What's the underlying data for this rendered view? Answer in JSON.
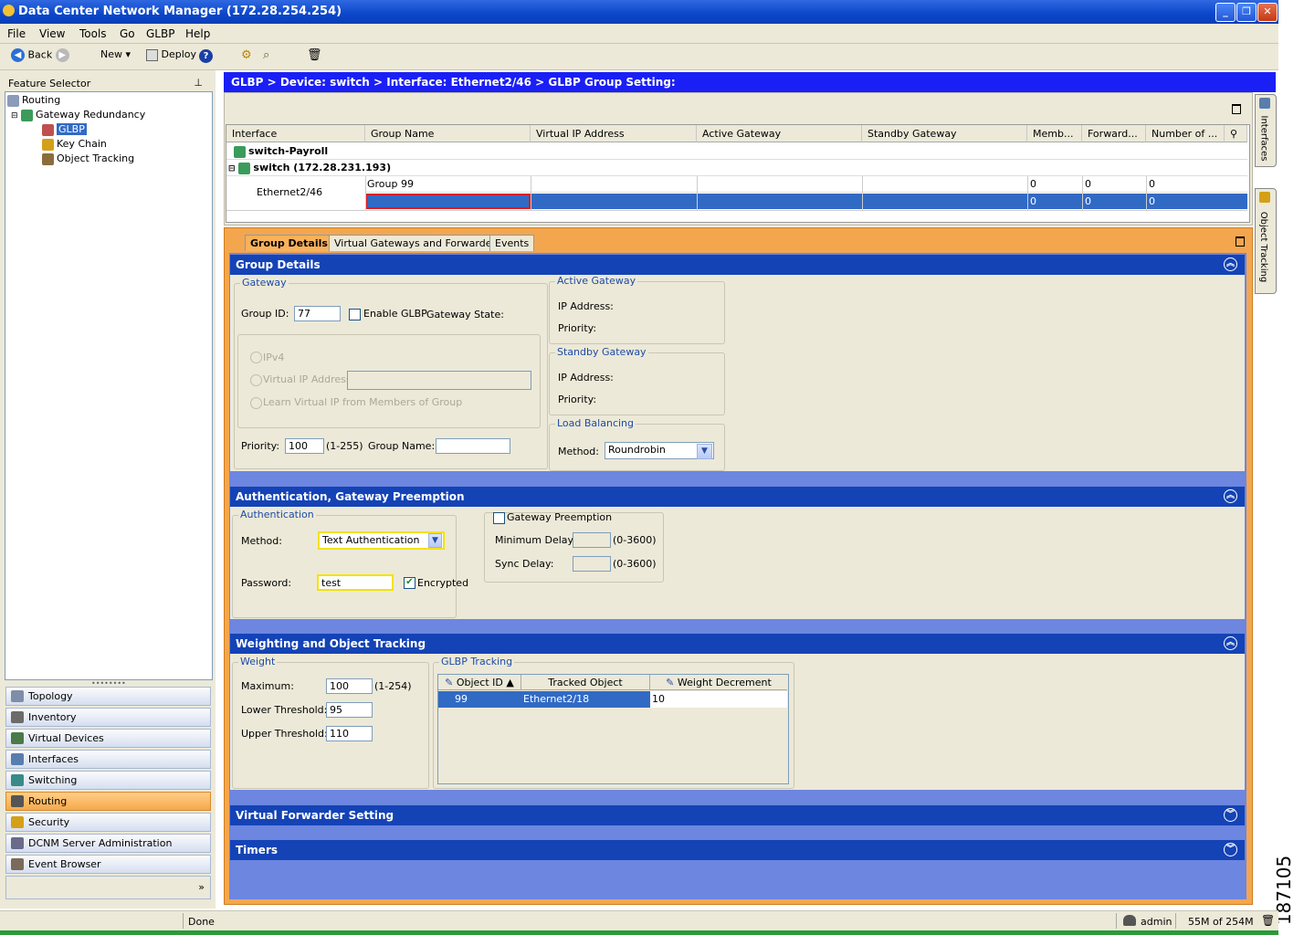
{
  "window": {
    "title": "Data Center Network Manager (172.28.254.254)"
  },
  "menu": [
    "File",
    "View",
    "Tools",
    "Go",
    "GLBP",
    "Help"
  ],
  "toolbar": {
    "back": "Back",
    "new": "New",
    "deploy": "Deploy"
  },
  "feature_selector": {
    "title": "Feature Selector",
    "tree": [
      "Routing",
      "Gateway Redundancy",
      "GLBP",
      "Key Chain",
      "Object Tracking"
    ]
  },
  "nav": [
    {
      "label": "Topology",
      "selected": false
    },
    {
      "label": "Inventory",
      "selected": false
    },
    {
      "label": "Virtual Devices",
      "selected": false
    },
    {
      "label": "Interfaces",
      "selected": false
    },
    {
      "label": "Switching",
      "selected": false
    },
    {
      "label": "Routing",
      "selected": true
    },
    {
      "label": "Security",
      "selected": false
    },
    {
      "label": "DCNM Server Administration",
      "selected": false
    },
    {
      "label": "Event Browser",
      "selected": false
    }
  ],
  "breadcrumb": "GLBP > Device: switch > Interface: Ethernet2/46 > GLBP Group Setting:",
  "grid": {
    "columns": [
      "Interface",
      "Group Name",
      "Virtual IP Address",
      "Active Gateway",
      "Standby Gateway",
      "Memb...",
      "Forward...",
      "Number of ..."
    ],
    "device1": "switch-Payroll",
    "device2": "switch (172.28.231.193)",
    "interface": "Ethernet2/46",
    "row1": {
      "group": "Group 99",
      "memb": "0",
      "forward": "0",
      "number": "0"
    },
    "row2": {
      "group": "",
      "memb": "0",
      "forward": "0",
      "number": "0"
    }
  },
  "tabs": [
    "Group Details",
    "Virtual Gateways and Forwarders",
    "Events"
  ],
  "group_details": {
    "title": "Group Details",
    "gateway_title": "Gateway",
    "group_id_label": "Group ID:",
    "group_id": "77",
    "enable_glbp": "Enable GLBP",
    "gateway_state": "Gateway State:",
    "ipv4": "IPv4",
    "virtual_ip": "Virtual IP Address",
    "learn_vip": "Learn Virtual IP from Members of Group",
    "priority_label": "Priority:",
    "priority": "100",
    "priority_range": "(1-255)",
    "group_name_label": "Group Name:",
    "active_gateway": "Active Gateway",
    "standby_gateway": "Standby Gateway",
    "ip_address": "IP Address:",
    "priority2": "Priority:",
    "load_balancing": "Load Balancing",
    "method_label": "Method:",
    "method": "Roundrobin"
  },
  "auth": {
    "title": "Authentication, Gateway Preemption",
    "auth_title": "Authentication",
    "method_label": "Method:",
    "method": "Text Authentication",
    "password_label": "Password:",
    "password": "test",
    "encrypted": "Encrypted",
    "preemption": "Gateway Preemption",
    "min_delay": "Minimum Delay:",
    "sync_delay": "Sync Delay:",
    "range": "(0-3600)"
  },
  "weighting": {
    "title": "Weighting and Object Tracking",
    "weight_title": "Weight",
    "max_label": "Maximum:",
    "max": "100",
    "max_range": "(1-254)",
    "lower_label": "Lower Threshold:",
    "lower": "95",
    "upper_label": "Upper Threshold:",
    "upper": "110",
    "tracking_title": "GLBP Tracking",
    "cols": [
      "Object ID",
      "Tracked Object",
      "Weight Decrement"
    ],
    "row": {
      "id": "99",
      "obj": "Ethernet2/18",
      "dec": "10"
    }
  },
  "virtual_forwarder": "Virtual Forwarder Setting",
  "timers": "Timers",
  "side_tabs": [
    "Interfaces",
    "Object Tracking"
  ],
  "status": {
    "text": "Done",
    "user": "admin",
    "memory": "55M of 254M"
  },
  "figure_id": "187105"
}
